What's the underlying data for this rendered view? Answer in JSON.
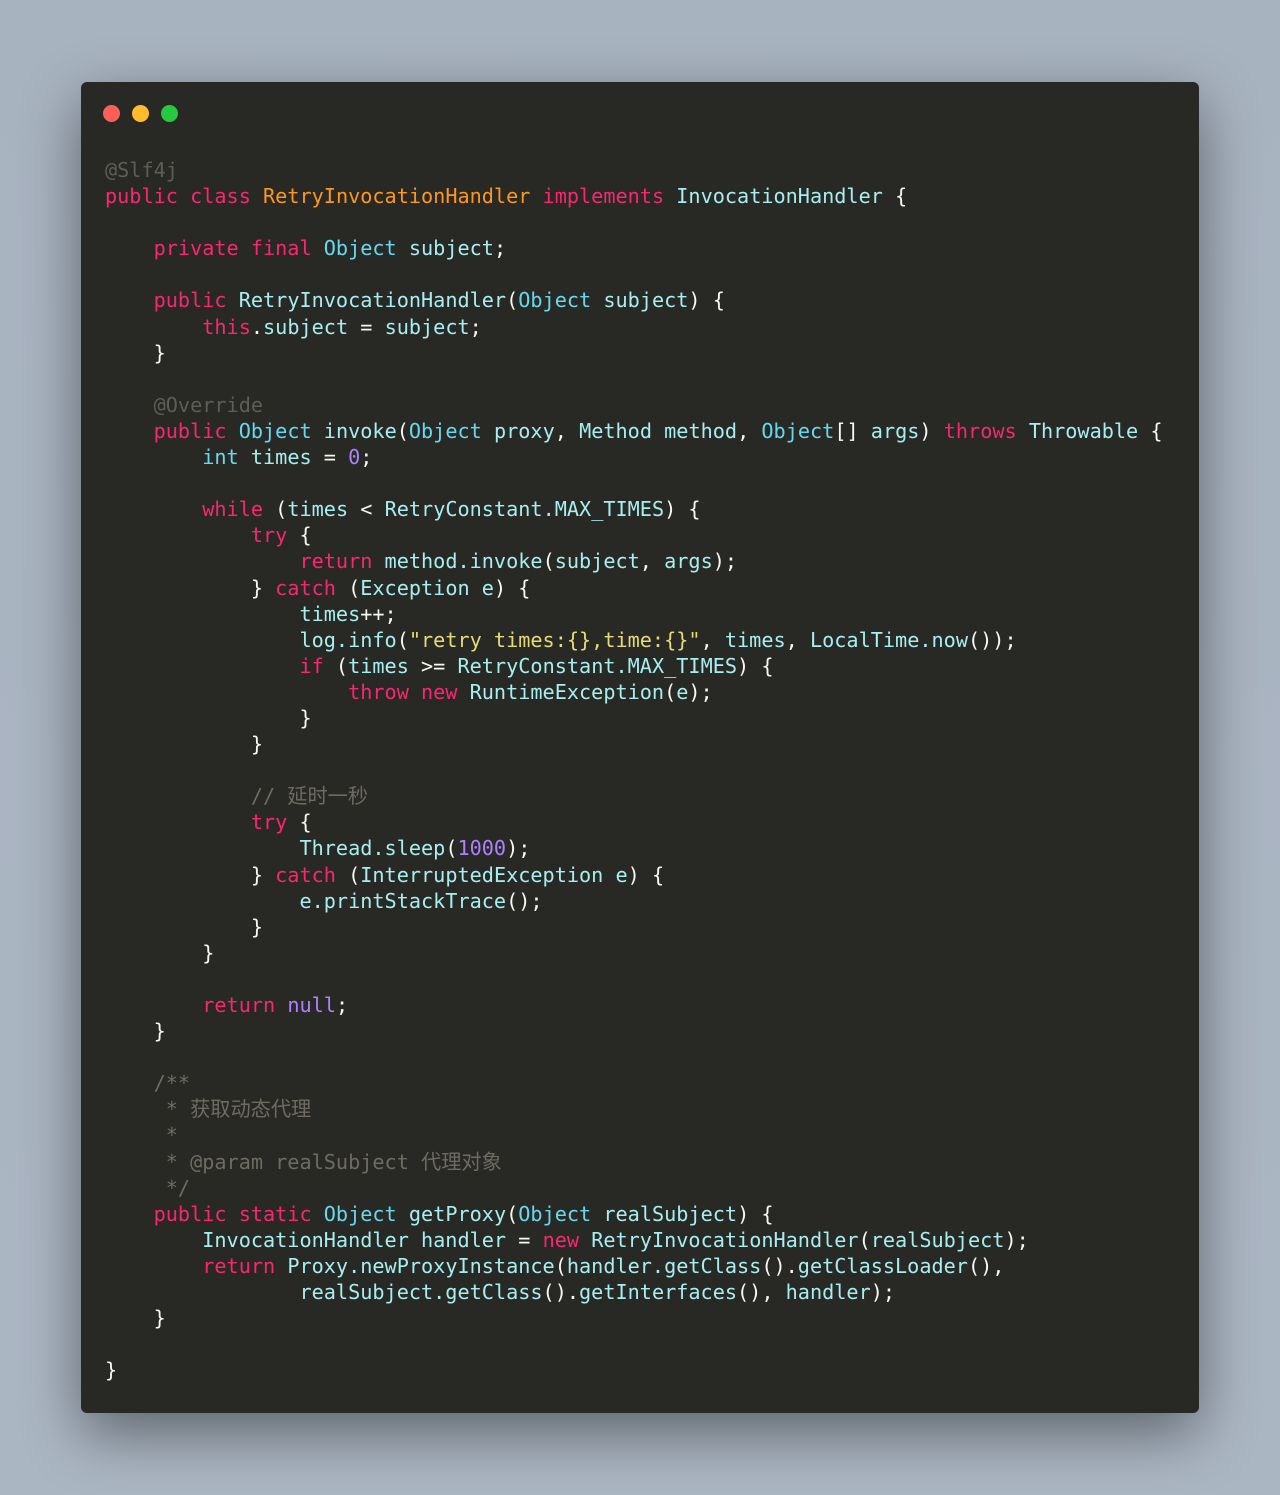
{
  "window": {
    "controls": [
      {
        "name": "close-button",
        "color": "#ff5f56"
      },
      {
        "name": "minimize-button",
        "color": "#ffbd2e"
      },
      {
        "name": "maximize-button",
        "color": "#27c93f"
      }
    ]
  },
  "colors": {
    "background": "#282824",
    "keyword": "#f92672",
    "class": "#fd971f",
    "type": "#66d9ef",
    "string": "#e6db74",
    "number": "#ae81ff",
    "comment": "#6e6c62"
  },
  "code": {
    "lines": [
      [
        [
          "a",
          "@Slf4j"
        ]
      ],
      [
        [
          "k",
          "public class "
        ],
        [
          "c",
          "RetryInvocationHandler"
        ],
        [
          "k",
          " implements "
        ],
        [
          "i",
          "InvocationHandler"
        ],
        [
          "p",
          " {"
        ]
      ],
      [],
      [
        [
          "k",
          "    private final "
        ],
        [
          "t",
          "Object"
        ],
        [
          "i",
          " subject"
        ],
        [
          "p",
          ";"
        ]
      ],
      [],
      [
        [
          "k",
          "    public "
        ],
        [
          "i",
          "RetryInvocationHandler"
        ],
        [
          "p",
          "("
        ],
        [
          "t",
          "Object"
        ],
        [
          "i",
          " subject"
        ],
        [
          "p",
          ") {"
        ]
      ],
      [
        [
          "k",
          "        this"
        ],
        [
          "p",
          "."
        ],
        [
          "i",
          "subject"
        ],
        [
          "p",
          " = "
        ],
        [
          "i",
          "subject"
        ],
        [
          "p",
          ";"
        ]
      ],
      [
        [
          "p",
          "    }"
        ]
      ],
      [],
      [
        [
          "a",
          "    @Override"
        ]
      ],
      [
        [
          "k",
          "    public "
        ],
        [
          "t",
          "Object"
        ],
        [
          "i",
          " invoke"
        ],
        [
          "p",
          "("
        ],
        [
          "t",
          "Object"
        ],
        [
          "i",
          " proxy"
        ],
        [
          "p",
          ", "
        ],
        [
          "i",
          "Method method"
        ],
        [
          "p",
          ", "
        ],
        [
          "t",
          "Object"
        ],
        [
          "p",
          "[] "
        ],
        [
          "i",
          "args"
        ],
        [
          "p",
          ") "
        ],
        [
          "k",
          "throws "
        ],
        [
          "i",
          "Throwable"
        ],
        [
          "p",
          " {"
        ]
      ],
      [
        [
          "t",
          "        int"
        ],
        [
          "i",
          " times"
        ],
        [
          "p",
          " = "
        ],
        [
          "n",
          "0"
        ],
        [
          "p",
          ";"
        ]
      ],
      [],
      [
        [
          "k",
          "        while"
        ],
        [
          "p",
          " ("
        ],
        [
          "i",
          "times"
        ],
        [
          "p",
          " < "
        ],
        [
          "i",
          "RetryConstant.MAX_TIMES"
        ],
        [
          "p",
          ") {"
        ]
      ],
      [
        [
          "k",
          "            try"
        ],
        [
          "p",
          " {"
        ]
      ],
      [
        [
          "k",
          "                return "
        ],
        [
          "i",
          "method.invoke"
        ],
        [
          "p",
          "("
        ],
        [
          "i",
          "subject"
        ],
        [
          "p",
          ", "
        ],
        [
          "i",
          "args"
        ],
        [
          "p",
          ");"
        ]
      ],
      [
        [
          "p",
          "            } "
        ],
        [
          "k",
          "catch"
        ],
        [
          "p",
          " ("
        ],
        [
          "i",
          "Exception e"
        ],
        [
          "p",
          ") {"
        ]
      ],
      [
        [
          "i",
          "                times"
        ],
        [
          "p",
          "++;"
        ]
      ],
      [
        [
          "i",
          "                log.info"
        ],
        [
          "p",
          "("
        ],
        [
          "s",
          "\"retry times:{},time:{}\""
        ],
        [
          "p",
          ", "
        ],
        [
          "i",
          "times"
        ],
        [
          "p",
          ", "
        ],
        [
          "i",
          "LocalTime.now"
        ],
        [
          "p",
          "());"
        ]
      ],
      [
        [
          "k",
          "                if"
        ],
        [
          "p",
          " ("
        ],
        [
          "i",
          "times"
        ],
        [
          "p",
          " >= "
        ],
        [
          "i",
          "RetryConstant.MAX_TIMES"
        ],
        [
          "p",
          ") {"
        ]
      ],
      [
        [
          "k",
          "                    throw new "
        ],
        [
          "i",
          "RuntimeException"
        ],
        [
          "p",
          "("
        ],
        [
          "i",
          "e"
        ],
        [
          "p",
          ");"
        ]
      ],
      [
        [
          "p",
          "                }"
        ]
      ],
      [
        [
          "p",
          "            }"
        ]
      ],
      [],
      [
        [
          "m",
          "            // 延时一秒"
        ]
      ],
      [
        [
          "k",
          "            try"
        ],
        [
          "p",
          " {"
        ]
      ],
      [
        [
          "i",
          "                Thread.sleep"
        ],
        [
          "p",
          "("
        ],
        [
          "n",
          "1000"
        ],
        [
          "p",
          ");"
        ]
      ],
      [
        [
          "p",
          "            } "
        ],
        [
          "k",
          "catch"
        ],
        [
          "p",
          " ("
        ],
        [
          "i",
          "InterruptedException e"
        ],
        [
          "p",
          ") {"
        ]
      ],
      [
        [
          "i",
          "                e.printStackTrace"
        ],
        [
          "p",
          "();"
        ]
      ],
      [
        [
          "p",
          "            }"
        ]
      ],
      [
        [
          "p",
          "        }"
        ]
      ],
      [],
      [
        [
          "k",
          "        return "
        ],
        [
          "n",
          "null"
        ],
        [
          "p",
          ";"
        ]
      ],
      [
        [
          "p",
          "    }"
        ]
      ],
      [],
      [
        [
          "m",
          "    /**"
        ]
      ],
      [
        [
          "m",
          "     * 获取动态代理"
        ]
      ],
      [
        [
          "m",
          "     *"
        ]
      ],
      [
        [
          "m",
          "     * @param realSubject 代理对象"
        ]
      ],
      [
        [
          "m",
          "     */"
        ]
      ],
      [
        [
          "k",
          "    public static "
        ],
        [
          "t",
          "Object"
        ],
        [
          "i",
          " getProxy"
        ],
        [
          "p",
          "("
        ],
        [
          "t",
          "Object"
        ],
        [
          "i",
          " realSubject"
        ],
        [
          "p",
          ") {"
        ]
      ],
      [
        [
          "i",
          "        InvocationHandler handler"
        ],
        [
          "p",
          " = "
        ],
        [
          "k",
          "new "
        ],
        [
          "i",
          "RetryInvocationHandler"
        ],
        [
          "p",
          "("
        ],
        [
          "i",
          "realSubject"
        ],
        [
          "p",
          ");"
        ]
      ],
      [
        [
          "k",
          "        return "
        ],
        [
          "i",
          "Proxy.newProxyInstance"
        ],
        [
          "p",
          "("
        ],
        [
          "i",
          "handler.getClass"
        ],
        [
          "p",
          "()."
        ],
        [
          "i",
          "getClassLoader"
        ],
        [
          "p",
          "(),"
        ]
      ],
      [
        [
          "i",
          "                realSubject.getClass"
        ],
        [
          "p",
          "()."
        ],
        [
          "i",
          "getInterfaces"
        ],
        [
          "p",
          "(), "
        ],
        [
          "i",
          "handler"
        ],
        [
          "p",
          ");"
        ]
      ],
      [
        [
          "p",
          "    }"
        ]
      ],
      [],
      [
        [
          "p",
          "}"
        ]
      ]
    ]
  }
}
